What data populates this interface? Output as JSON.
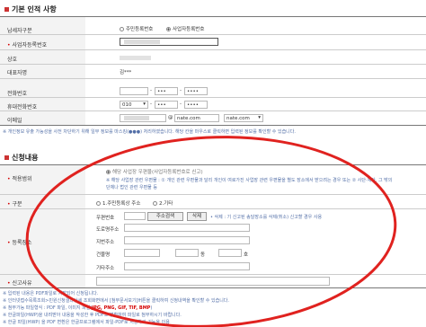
{
  "basic": {
    "title": "기본 인적 사항",
    "applicant_type_label": "납세자구분",
    "radio_resident": "주민등록번호",
    "radio_business": "사업자등록번호",
    "bizno_label": "사업자등록번호",
    "company_label": "상호",
    "rep_label": "대표자명",
    "rep_value": "김***",
    "phone_label": "전화번호",
    "mobile_label": "휴대전화번호",
    "mobile_prefix": "010",
    "email_label": "이메일",
    "email_at": "@",
    "email_domain": "nate.com",
    "email_select": "nate.com",
    "masked_short": "•••",
    "masked_long": "••••"
  },
  "privacy_note": "※ 개인정보 유출 가능성을 사전 차단하기 위해 일부 정보를 마스킹(●●●) 처리하였습니다. 해당 칸을 마우스로 클릭하면 입력된 정보를 확인할 수 있습니다.",
  "apply": {
    "title": "신청내용",
    "scope_label": "적용범위",
    "scope_option": "해당 사업장 우편물(사업자등록번호로 신고)",
    "scope_desc": "※ 해당 사업장 관련 우편물 : ① 개인 관련 우편물과 달리 개인이 여로가진 사업장 관련 우편물을 별도 장소에서 받으려는 경우 또는 ② 사단·재단, 그 밖의 단체나 법인 관련 우편물 등",
    "type_label": "구분",
    "type_opt1": "1.주민등록상 주소",
    "type_opt2": "2.기타",
    "addr_label": "등록장소",
    "postcode_label": "우편번호",
    "search_btn": "주소검색",
    "delete_btn": "삭제",
    "delete_note": "• 삭제 : 기 신고된 송달장소를 삭제(취소) 신고할 경우 사용",
    "road_label": "도로명주소",
    "lot_label": "지번주소",
    "building_label": "건물명",
    "dong_unit": "동",
    "ho_unit": "호",
    "etc_label": "기타주소",
    "reason_label": "신고사유"
  },
  "footer": {
    "line1": "※ 입력된 내용은 PDF파일로 저장되어 신청됩니다.",
    "line2": "※ 인터넷접수목록조회>민원신청결과상세 조회화면에서 [첨부문서보기]버튼을 클릭하여 신청내역을 확인할 수 있습니다.",
    "line3_a": "※ 첨부가능 파일형식 : PDF 파일, 이미지 파일(",
    "line3_formats": "JPG, PNG, GIF, TIF, BMP",
    "line3_b": ")",
    "line4": "※ 한글파일(HWP)을 내려받아 내용을 작성한 후 PDF로 변환하여 파일로 첨부하시기 바랍니다.",
    "line5": "※ 한글 파일(HWP) 을 PDF 변환은 한글프로그램에서 파일-PDF로 저장하기 기능을 이용"
  }
}
